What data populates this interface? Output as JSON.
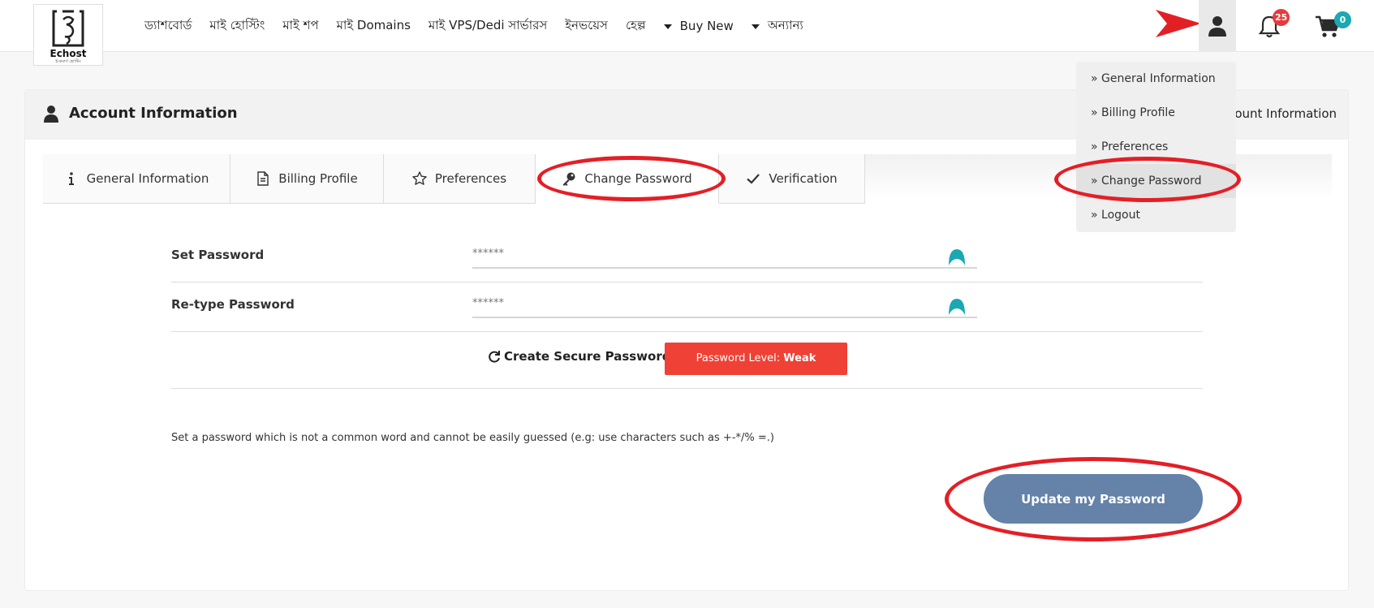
{
  "brand": {
    "name": "Echost",
    "tagline": "ই-কমার্স হোস্টিং"
  },
  "nav": {
    "items": [
      "ড্যাশবোর্ড",
      "মাই হোস্টিং",
      "মাই শপ",
      "মাই Domains",
      "মাই VPS/Dedi সার্ভারস",
      "ইনভয়েস",
      "হেল্প"
    ],
    "buy_new": "Buy New",
    "others": "অন্যান্য"
  },
  "header_icons": {
    "notifications_count": "25",
    "cart_count": "0"
  },
  "account": {
    "title": "Account Information",
    "right_title": "ount Information"
  },
  "tabs": [
    {
      "label": "General Information",
      "icon": "info-icon"
    },
    {
      "label": "Billing Profile",
      "icon": "document-icon"
    },
    {
      "label": "Preferences",
      "icon": "star-icon"
    },
    {
      "label": "Change Password",
      "icon": "key-icon"
    },
    {
      "label": "Verification",
      "icon": "check-icon"
    }
  ],
  "form": {
    "set_password_label": "Set Password",
    "set_password_placeholder": "******",
    "retype_password_label": "Re-type Password",
    "retype_password_placeholder": "******",
    "generate_label": "Create Secure Password",
    "level_label": "Password Level: ",
    "level_value": "Weak",
    "hint": "Set a password which is not a common word and cannot be easily guessed (e.g: use characters such as +-*/% =.)",
    "submit_label": "Update my Password"
  },
  "dropdown": {
    "items": [
      "» General Information",
      "» Billing Profile",
      "» Preferences",
      "» Change Password",
      "» Logout"
    ]
  },
  "colors": {
    "annotation": "#e31f26",
    "submit_button": "#6582a8",
    "weak_level": "#ef4135",
    "notification_badge": "#e53b3b",
    "cart_badge": "#1aa8b2"
  }
}
